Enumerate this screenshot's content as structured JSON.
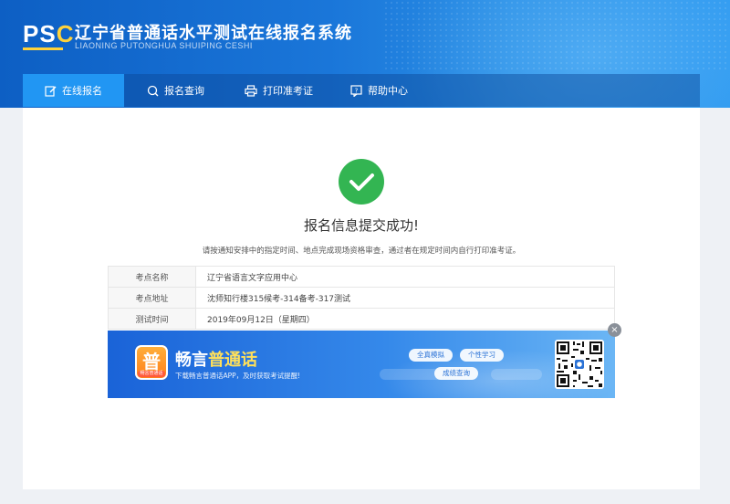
{
  "header": {
    "logo": {
      "p": "P",
      "s": "S",
      "c": "C"
    },
    "title": "辽宁省普通话水平测试在线报名系统",
    "subtitle": "LIAONING PUTONGHUA SHUIPING CESHI"
  },
  "nav": [
    {
      "label": "在线报名",
      "icon": "edit-icon",
      "active": true
    },
    {
      "label": "报名查询",
      "icon": "search-icon",
      "active": false
    },
    {
      "label": "打印准考证",
      "icon": "printer-icon",
      "active": false
    },
    {
      "label": "帮助中心",
      "icon": "help-icon",
      "active": false
    }
  ],
  "result": {
    "icon": "checkmark-icon",
    "title": "报名信息提交成功!",
    "notice": "请按通知安排中的指定时间、地点完成现场资格审查，通过者在规定时间内自行打印准考证。"
  },
  "info_rows": [
    {
      "key": "考点名称",
      "value": "辽宁省语言文字应用中心"
    },
    {
      "key": "考点地址",
      "value": "沈师知行楼315候考-314备考-317测试"
    },
    {
      "key": "测试时间",
      "value": "2019年09月12日（星期四）"
    }
  ],
  "banner": {
    "app_icon_char": "普",
    "app_icon_tag": "畅言普通话",
    "app_name_1": "畅言",
    "app_name_2": "普通话",
    "description": "下载畅言普通话APP，及时获取考试提醒!",
    "pills": [
      "全真模拟",
      "个性学习",
      "成绩查询"
    ],
    "close": "×"
  },
  "colors": {
    "header_blue": "#1a76d9",
    "nav_active": "#2196f3",
    "success_green": "#33b552",
    "logo_accent": "#ffd23a"
  }
}
